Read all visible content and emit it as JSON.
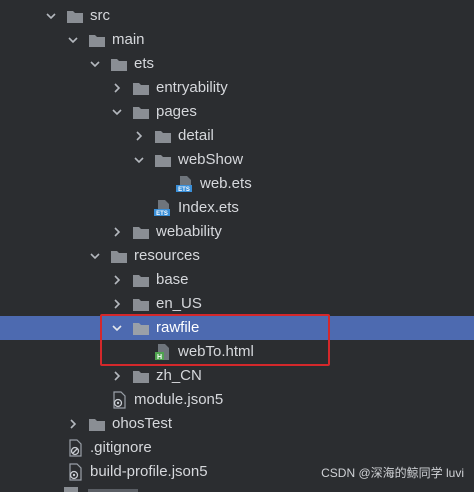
{
  "tree": {
    "items": [
      {
        "label": "src",
        "icon": "folder-icon",
        "expanded": true
      },
      {
        "label": "main",
        "icon": "folder-icon",
        "expanded": true
      },
      {
        "label": "ets",
        "icon": "folder-icon",
        "expanded": true
      },
      {
        "label": "entryability",
        "icon": "folder-icon",
        "expanded": false
      },
      {
        "label": "pages",
        "icon": "folder-icon",
        "expanded": true
      },
      {
        "label": "detail",
        "icon": "folder-icon",
        "expanded": false
      },
      {
        "label": "webShow",
        "icon": "folder-icon",
        "expanded": true
      },
      {
        "label": "web.ets",
        "icon": "ets-file-icon",
        "badge": "ETS"
      },
      {
        "label": "Index.ets",
        "icon": "ets-file-icon",
        "badge": "ETS"
      },
      {
        "label": "webability",
        "icon": "folder-icon",
        "expanded": false
      },
      {
        "label": "resources",
        "icon": "folder-icon",
        "expanded": true
      },
      {
        "label": "base",
        "icon": "folder-icon",
        "expanded": false
      },
      {
        "label": "en_US",
        "icon": "folder-icon",
        "expanded": false
      },
      {
        "label": "rawfile",
        "icon": "folder-icon",
        "expanded": true,
        "selected": true
      },
      {
        "label": "webTo.html",
        "icon": "html-file-icon",
        "badge": "H"
      },
      {
        "label": "zh_CN",
        "icon": "folder-icon",
        "expanded": false
      },
      {
        "label": "module.json5",
        "icon": "json5-file-icon"
      },
      {
        "label": "ohosTest",
        "icon": "folder-icon",
        "expanded": false
      },
      {
        "label": ".gitignore",
        "icon": "gitignore-file-icon"
      },
      {
        "label": "build-profile.json5",
        "icon": "json5-file-icon"
      }
    ]
  },
  "watermark": "CSDN @深海的鲸同学 luvi",
  "colors": {
    "background": "#2b2d30",
    "selection": "#4d6ab0",
    "highlight_border": "#d4282b",
    "folder": "#8a8e94",
    "ets_badge": "#3a8fd8",
    "html_badge": "#4fa34f"
  }
}
